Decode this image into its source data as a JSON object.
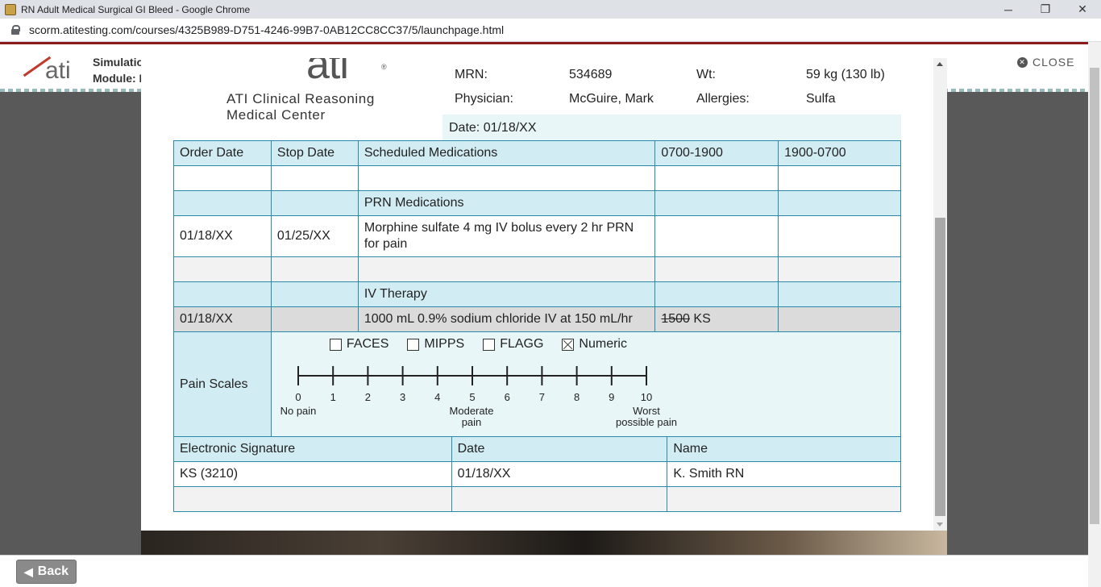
{
  "browser": {
    "title": "RN Adult Medical Surgical GI Bleed - Google Chrome",
    "url": "scorm.atitesting.com/courses/4325B989-D751-4246-99B7-0AB12CC8CC37/5/launchpage.html",
    "minimize": "─",
    "restore": "❐",
    "close": "✕"
  },
  "app": {
    "sim_label": "Simulatio",
    "module_label": "Module: I",
    "close_label": "CLOSE",
    "back_label": "Back"
  },
  "mar": {
    "center_name_line1": "ATI Clinical Reasoning",
    "center_name_line2": "Medical Center",
    "logo_text": "ati",
    "patient": {
      "mrn_label": "MRN:",
      "mrn": "534689",
      "wt_label": "Wt:",
      "wt": "59 kg (130 lb)",
      "physician_label": "Physician:",
      "physician": "McGuire, Mark",
      "allergies_label": "Allergies:",
      "allergies": "Sulfa"
    },
    "date_line": "Date: 01/18/XX",
    "headers": [
      "Order Date",
      "Stop Date",
      "Scheduled Medications",
      "0700-1900",
      "1900-0700"
    ],
    "prn_heading": "PRN Medications",
    "prn_med": {
      "order_date": "01/18/XX",
      "stop_date": "01/25/XX",
      "medication": "Morphine sulfate 4 mg IV bolus every 2 hr PRN for pain"
    },
    "iv_heading": "IV Therapy",
    "iv_row": {
      "order_date": "01/18/XX",
      "therapy": "1000 mL 0.9% sodium chloride IV at 150 mL/hr",
      "time_struck": "1500",
      "initials": "KS"
    },
    "pain": {
      "label": "Pain Scales",
      "options": [
        {
          "label": "FACES",
          "checked": false
        },
        {
          "label": "MIPPS",
          "checked": false
        },
        {
          "label": "FLAGG",
          "checked": false
        },
        {
          "label": "Numeric",
          "checked": true
        }
      ],
      "ticks": [
        "0",
        "1",
        "2",
        "3",
        "4",
        "5",
        "6",
        "7",
        "8",
        "9",
        "10"
      ],
      "anchor_left": "No pain",
      "anchor_mid_1": "Moderate",
      "anchor_mid_2": "pain",
      "anchor_right_1": "Worst",
      "anchor_right_2": "possible pain"
    },
    "signature": {
      "headers": [
        "Electronic Signature",
        "Date",
        "Name"
      ],
      "rows": [
        [
          "KS (3210)",
          "01/18/XX",
          "K. Smith RN"
        ]
      ]
    }
  }
}
